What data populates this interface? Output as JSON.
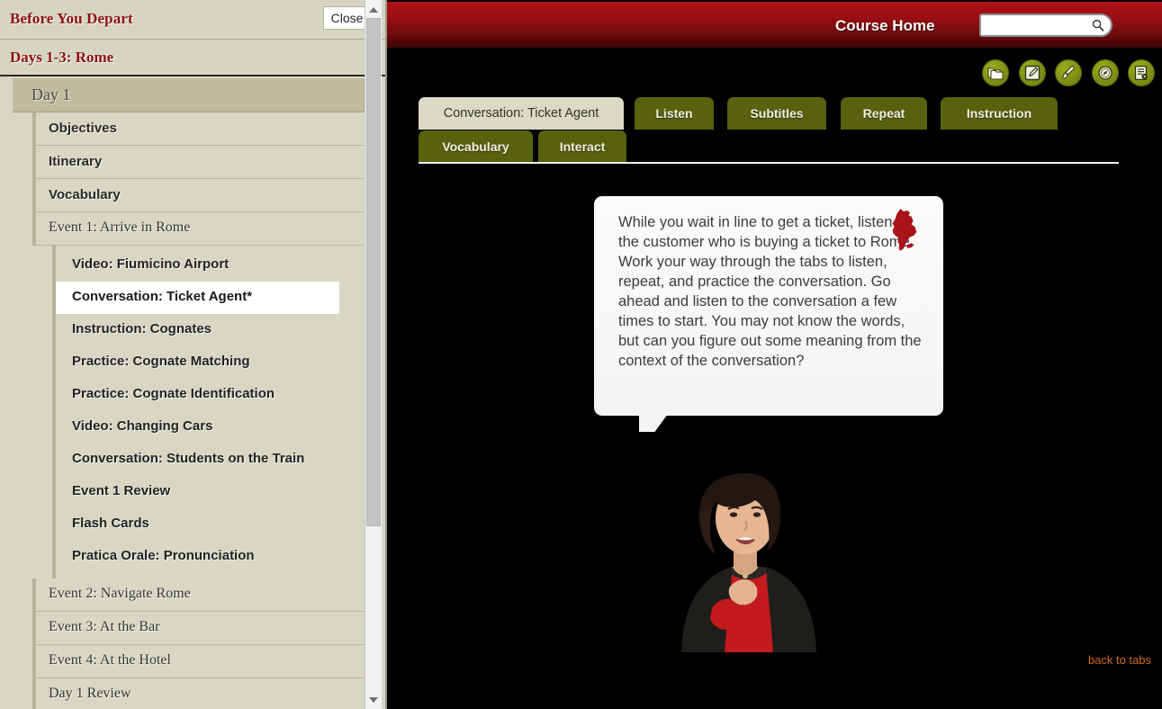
{
  "sidebar": {
    "header_title": "Before You Depart",
    "close_label": "Close",
    "sub_title": "Days 1-3: Rome",
    "day_label": "Day 1",
    "items": [
      {
        "label": "Objectives",
        "style": "sans",
        "level": 2
      },
      {
        "label": "Itinerary",
        "style": "sans",
        "level": 2
      },
      {
        "label": "Vocabulary",
        "style": "sans",
        "level": 2
      },
      {
        "label": "Event 1: Arrive in Rome",
        "style": "serif",
        "level": 2
      }
    ],
    "event1_children": [
      {
        "label": "Video: Fiumicino Airport",
        "active": false
      },
      {
        "label": "Conversation: Ticket Agent*",
        "active": true
      },
      {
        "label": "Instruction: Cognates",
        "active": false
      },
      {
        "label": "Practice: Cognate Matching",
        "active": false
      },
      {
        "label": "Practice: Cognate Identification",
        "active": false
      },
      {
        "label": "Video: Changing Cars",
        "active": false
      },
      {
        "label": "Conversation: Students on the Train",
        "active": false
      },
      {
        "label": "Event 1 Review",
        "active": false
      },
      {
        "label": "Flash Cards",
        "active": false
      },
      {
        "label": "Pratica Orale: Pronunciation",
        "active": false
      }
    ],
    "items_after": [
      {
        "label": "Event 2: Navigate Rome",
        "style": "serif",
        "level": 2
      },
      {
        "label": "Event 3: At the Bar",
        "style": "serif",
        "level": 2
      },
      {
        "label": "Event 4: At the Hotel",
        "style": "serif",
        "level": 2
      },
      {
        "label": "Day 1 Review",
        "style": "serif",
        "level": 2
      }
    ]
  },
  "topbar": {
    "breadcrumb": "Course Home",
    "search_value": "",
    "search_placeholder": ""
  },
  "toolbar_icons": [
    {
      "name": "folder-icon"
    },
    {
      "name": "notepad-edit-icon"
    },
    {
      "name": "paintbrush-icon"
    },
    {
      "name": "compass-icon"
    },
    {
      "name": "document-settings-icon"
    }
  ],
  "tabs": {
    "row1": [
      {
        "label": "Conversation: Ticket Agent",
        "selected": true
      },
      {
        "label": "Listen",
        "selected": false
      },
      {
        "label": "Subtitles",
        "selected": false
      },
      {
        "label": "Repeat",
        "selected": false
      },
      {
        "label": "Instruction",
        "selected": false
      }
    ],
    "row2": [
      {
        "label": "Vocabulary",
        "selected": false
      },
      {
        "label": "Interact",
        "selected": false
      }
    ]
  },
  "bubble": {
    "text": "While you wait in line to get a ticket, listen to the customer who is buying a ticket to Rome. Work your way through the tabs to listen, repeat, and practice the conversation. Go ahead and listen to the conversation a few times to start. You may not know the words, but can you figure out some meaning from the context of the conversation?",
    "flag_icon": "italy-map-icon"
  },
  "presenter": {
    "alt": "presenter-photo"
  },
  "footer": {
    "back_to_tabs": "back to tabs"
  },
  "colors": {
    "brand_red": "#9d0f13",
    "olive": "#57610e",
    "sidebar_bg": "#d8d7c4",
    "title_red": "#8e1010",
    "link_orange": "#d2691e"
  }
}
